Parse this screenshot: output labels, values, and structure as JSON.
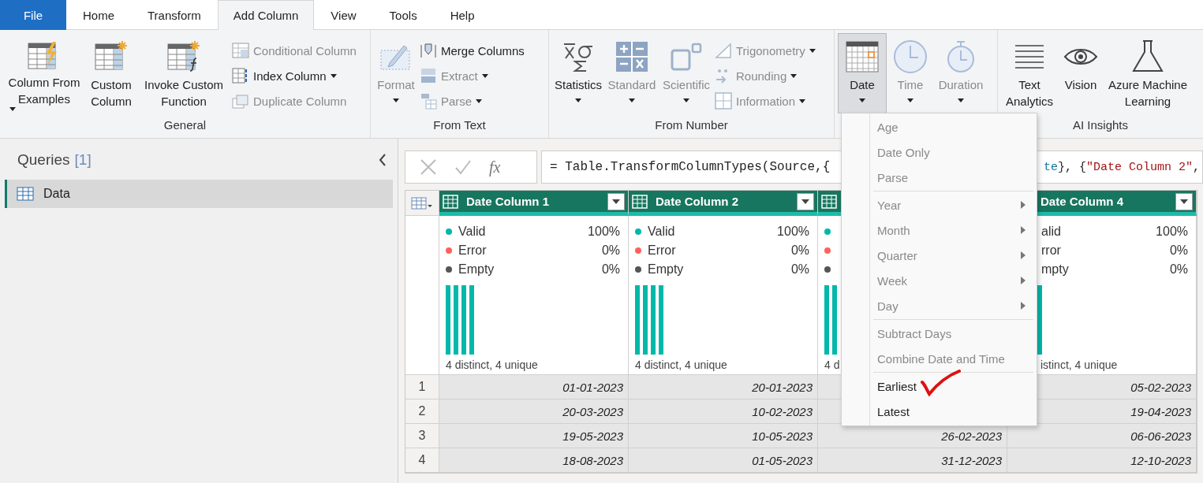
{
  "tabs": [
    {
      "label": "File",
      "kind": "file",
      "selected": false
    },
    {
      "label": "Home",
      "kind": "tab",
      "selected": false
    },
    {
      "label": "Transform",
      "kind": "tab",
      "selected": false
    },
    {
      "label": "Add Column",
      "kind": "tab",
      "selected": true
    },
    {
      "label": "View",
      "kind": "tab",
      "selected": false
    },
    {
      "label": "Tools",
      "kind": "tab",
      "selected": false
    },
    {
      "label": "Help",
      "kind": "tab",
      "selected": false
    }
  ],
  "ribbon": {
    "groups": [
      {
        "label": "General",
        "large": [
          {
            "label": "Column From Examples",
            "dropdown": true,
            "disabled": false,
            "pressed": false
          },
          {
            "label": "Custom Column",
            "dropdown": false,
            "disabled": false,
            "pressed": false
          },
          {
            "label": "Invoke Custom Function",
            "dropdown": false,
            "disabled": false,
            "pressed": false
          }
        ],
        "small": [
          {
            "label": "Conditional Column",
            "dropdown": false,
            "disabled": true
          },
          {
            "label": "Index Column",
            "dropdown": true,
            "disabled": false
          },
          {
            "label": "Duplicate Column",
            "dropdown": false,
            "disabled": true
          }
        ]
      },
      {
        "label": "From Text",
        "large": [
          {
            "label": "Format",
            "dropdown": true,
            "disabled": true,
            "pressed": false
          }
        ],
        "small": [
          {
            "label": "Merge Columns",
            "dropdown": false,
            "disabled": false
          },
          {
            "label": "Extract",
            "dropdown": true,
            "disabled": true
          },
          {
            "label": "Parse",
            "dropdown": true,
            "disabled": true
          }
        ]
      },
      {
        "label": "From Number",
        "large": [
          {
            "label": "Statistics",
            "dropdown": true,
            "disabled": false,
            "pressed": false
          },
          {
            "label": "Standard",
            "dropdown": true,
            "disabled": true,
            "pressed": false
          },
          {
            "label": "Scientific",
            "dropdown": true,
            "disabled": true,
            "pressed": false
          }
        ],
        "small": [
          {
            "label": "Trigonometry",
            "dropdown": true,
            "disabled": true
          },
          {
            "label": "Rounding",
            "dropdown": true,
            "disabled": true
          },
          {
            "label": "Information",
            "dropdown": true,
            "disabled": true
          }
        ]
      },
      {
        "large": [
          {
            "label": "Date",
            "dropdown": true,
            "disabled": false,
            "pressed": true
          },
          {
            "label": "Time",
            "dropdown": true,
            "disabled": true,
            "pressed": false
          },
          {
            "label": "Duration",
            "dropdown": true,
            "disabled": true,
            "pressed": false
          }
        ]
      },
      {
        "label": "AI Insights",
        "large": [
          {
            "label": "Text Analytics",
            "dropdown": false,
            "disabled": false,
            "pressed": false
          },
          {
            "label": "Vision",
            "dropdown": false,
            "disabled": false,
            "pressed": false
          },
          {
            "label": "Azure Machine Learning",
            "dropdown": false,
            "disabled": false,
            "pressed": false
          }
        ]
      }
    ]
  },
  "queries": {
    "title": "Queries",
    "count": "[1]",
    "items": [
      {
        "label": "Data",
        "selected": true
      }
    ]
  },
  "formula_bar": {
    "fx": "fx",
    "segments": [
      {
        "text": "= Table.TransformColumnTypes(Source,{",
        "kind": "plain"
      }
    ],
    "segments_after_menu": [
      {
        "text": "te",
        "kind": "type"
      },
      {
        "text": "}, {",
        "kind": "plain"
      },
      {
        "text": "\"Date Column 2\"",
        "kind": "string"
      },
      {
        "text": ",",
        "kind": "plain"
      }
    ]
  },
  "grid": {
    "columns": [
      {
        "title": "Date Column 1",
        "stats": [
          {
            "label": "Valid",
            "value": "100%",
            "color": "#01b8aa"
          },
          {
            "label": "Error",
            "value": "0%",
            "color": "#fd625e"
          },
          {
            "label": "Empty",
            "value": "0%",
            "color": "#555555"
          }
        ],
        "footer": "4 distinct, 4 unique"
      },
      {
        "title": "Date Column 2",
        "stats": [
          {
            "label": "Valid",
            "value": "100%",
            "color": "#01b8aa"
          },
          {
            "label": "Error",
            "value": "0%",
            "color": "#fd625e"
          },
          {
            "label": "Empty",
            "value": "0%",
            "color": "#555555"
          }
        ],
        "footer": "4 distinct, 4 unique"
      },
      {
        "stats": [
          {
            "color": "#01b8aa"
          },
          {
            "color": "#fd625e"
          },
          {
            "color": "#555555"
          }
        ],
        "footer": "4 d"
      },
      {
        "title": "Date Column 4",
        "stats": [
          {
            "label": "alid",
            "value": "100%"
          },
          {
            "label": "rror",
            "value": "0%"
          },
          {
            "label": "mpty",
            "value": "0%"
          }
        ],
        "footer": "istinct, 4 unique"
      }
    ],
    "rows": [
      {
        "number": "1",
        "cells": [
          "01-01-2023",
          "20-01-2023",
          null,
          "05-02-2023"
        ]
      },
      {
        "number": "2",
        "cells": [
          "20-03-2023",
          "10-02-2023",
          null,
          "19-04-2023"
        ]
      },
      {
        "number": "3",
        "cells": [
          "19-05-2023",
          "10-05-2023",
          "26-02-2023",
          "06-06-2023"
        ]
      },
      {
        "number": "4",
        "cells": [
          "18-08-2023",
          "01-05-2023",
          "31-12-2023",
          "12-10-2023"
        ]
      }
    ]
  },
  "date_menu": {
    "sections": [
      {
        "items": [
          {
            "label": "Age",
            "disabled": true,
            "submenu": false
          },
          {
            "label": "Date Only",
            "disabled": true,
            "submenu": false
          },
          {
            "label": "Parse",
            "disabled": true,
            "submenu": false
          }
        ]
      },
      {
        "items": [
          {
            "label": "Year",
            "disabled": true,
            "submenu": true
          },
          {
            "label": "Month",
            "disabled": true,
            "submenu": true
          },
          {
            "label": "Quarter",
            "disabled": true,
            "submenu": true
          },
          {
            "label": "Week",
            "disabled": true,
            "submenu": true
          },
          {
            "label": "Day",
            "disabled": true,
            "submenu": true
          }
        ]
      },
      {
        "items": [
          {
            "label": "Subtract Days",
            "disabled": true,
            "submenu": false
          },
          {
            "label": "Combine Date and Time",
            "disabled": true,
            "submenu": false
          }
        ]
      },
      {
        "items": [
          {
            "label": "Earliest",
            "disabled": false,
            "submenu": false
          },
          {
            "label": "Latest",
            "disabled": false,
            "submenu": false
          }
        ]
      }
    ]
  }
}
